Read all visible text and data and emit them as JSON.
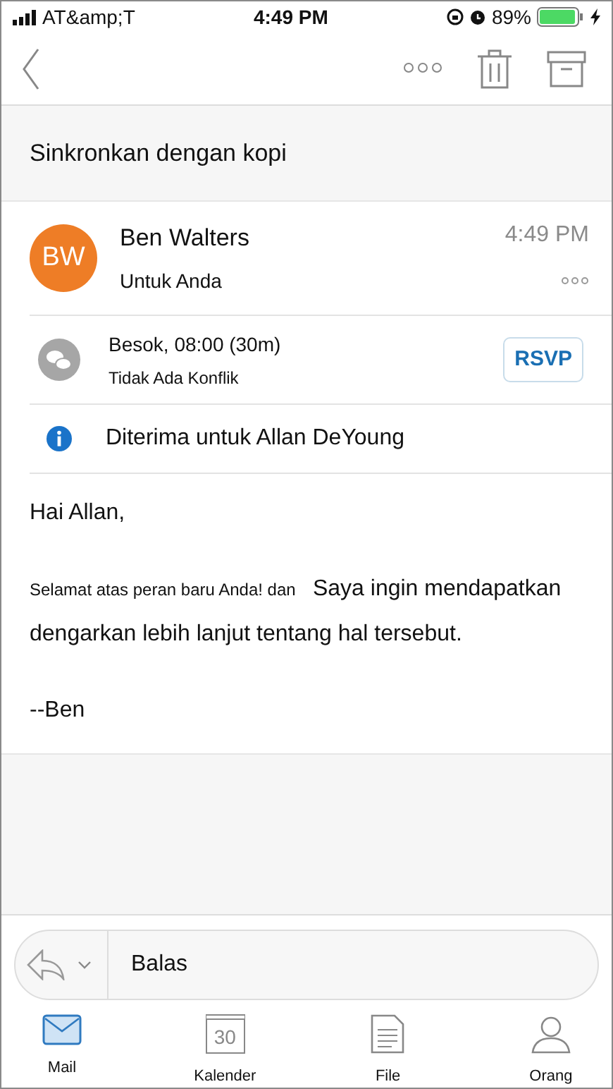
{
  "status_bar": {
    "carrier": "AT&amp;T",
    "time": "4:49 PM",
    "battery": "89%"
  },
  "subject": "Sinkronkan dengan kopi",
  "sender": {
    "initials": "BW",
    "color": "#ee7d26",
    "name": "Ben Walters",
    "recipient": "Untuk Anda",
    "time": "4:49 PM"
  },
  "meeting": {
    "when": "Besok, 08:00 (30m)",
    "conflict": "Tidak Ada Konflik",
    "rsvp": "RSVP"
  },
  "info": "Diterima untuk Allan DeYoung",
  "body": [
    {
      "parts": [
        {
          "kind": "normal",
          "text": "Hai Allan,"
        }
      ]
    },
    {
      "parts": [
        {
          "kind": "small",
          "text": "Selamat atas peran baru Anda! dan"
        },
        {
          "kind": "normal",
          "text": "Saya ingin mendapatkan dengarkan lebih lanjut tentang hal tersebut."
        }
      ]
    },
    {
      "parts": [
        {
          "kind": "normal",
          "text": "--Ben"
        }
      ]
    }
  ],
  "reply": {
    "label": "Balas"
  },
  "tabs": [
    {
      "kind": "mail",
      "label": "Mail",
      "selected": true
    },
    {
      "kind": "calendar",
      "label": "Kalender",
      "day": "30",
      "selected": false
    },
    {
      "kind": "file",
      "label": "File",
      "selected": false
    },
    {
      "kind": "people",
      "label": "Orang",
      "selected": false
    }
  ]
}
